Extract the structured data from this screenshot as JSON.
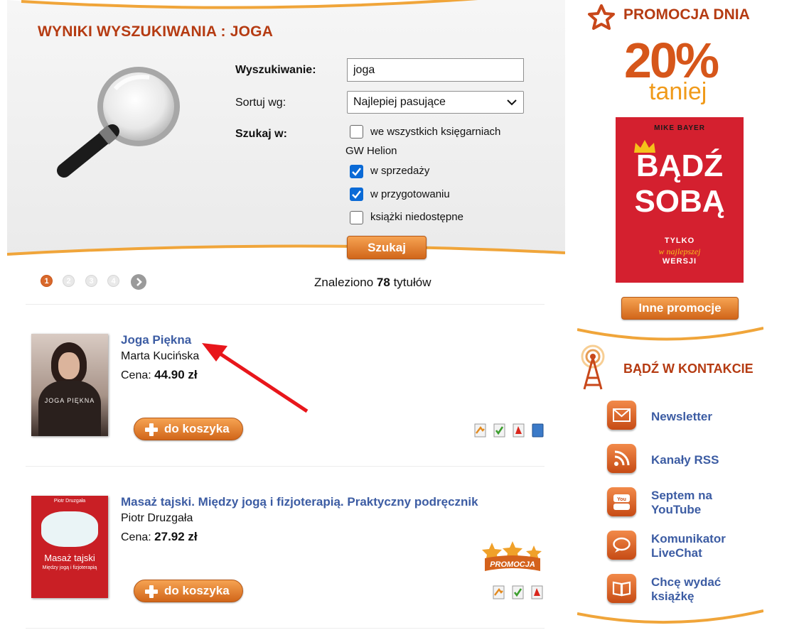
{
  "search": {
    "page_title": "WYNIKI WYSZUKIWANIA : JOGA",
    "search_label": "Wyszukiwanie:",
    "search_value": "joga",
    "sort_label": "Sortuj wg:",
    "sort_value": "Najlepiej pasujące",
    "search_in_label": "Szukaj w:",
    "options": [
      {
        "label": "we wszystkich księgarniach",
        "checked": false
      },
      {
        "label": "w sprzedaży",
        "checked": true
      },
      {
        "label": "w przygotowaniu",
        "checked": true
      },
      {
        "label": "książki niedostępne",
        "checked": false
      }
    ],
    "option_sub_label": "GW Helion",
    "submit_label": "Szukaj"
  },
  "pagination": {
    "pages": [
      "1",
      "2",
      "3",
      "4"
    ],
    "active": "1",
    "next_icon": "chevron-right-icon"
  },
  "results_info": {
    "prefix": "Znaleziono",
    "count": "78",
    "suffix": "tytułów"
  },
  "results": [
    {
      "title": "Joga Piękna",
      "author": "Marta Kucińska",
      "price_label": "Cena:",
      "price": "44.90 zł",
      "cart_label": "do koszyka",
      "cover_text": "JOGA PIĘKNA",
      "formats": [
        "print-icon",
        "epub-icon",
        "pdf-icon",
        "ebook-icon"
      ]
    },
    {
      "title": "Masaż tajski. Między jogą i fizjoterapią. Praktyczny podręcznik",
      "author": "Piotr Druzgała",
      "price_label": "Cena:",
      "price": "27.92 zł",
      "cart_label": "do koszyka",
      "cover_author": "Piotr Druzgała",
      "cover_title": "Masaż tajski",
      "cover_subtitle": "Między jogą i fizjoterapią",
      "badge": "PROMOCJA",
      "formats": [
        "print-icon",
        "epub-icon",
        "pdf-icon"
      ]
    }
  ],
  "sidebar": {
    "promo_heading": "PROMOCJA DNIA",
    "promo_percent": "20%",
    "promo_sub": "taniej",
    "promo_book": {
      "author": "MIKE BAYER",
      "title_line1": "BĄDŹ",
      "title_line2": "SOBĄ",
      "subtitle_line1": "TYLKO",
      "subtitle_line2": "w najlepszej",
      "subtitle_line3": "WERSJI"
    },
    "more_promos": "Inne promocje",
    "contact_heading": "BĄDŹ W KONTAKCIE",
    "contacts": [
      {
        "label": "Newsletter",
        "icon": "envelope-icon"
      },
      {
        "label": "Kanały RSS",
        "icon": "rss-icon"
      },
      {
        "label": "Septem na YouTube",
        "icon": "youtube-icon"
      },
      {
        "label": "Komunikator LiveChat",
        "icon": "chat-icon"
      },
      {
        "label": "Chcę wydać książkę",
        "icon": "book-icon"
      }
    ]
  },
  "colors": {
    "accent": "#b53b12",
    "link": "#3c5ca3",
    "button": "#e07a28",
    "checkbox": "#0a6ad6",
    "annotation_arrow": "#e8161b"
  }
}
